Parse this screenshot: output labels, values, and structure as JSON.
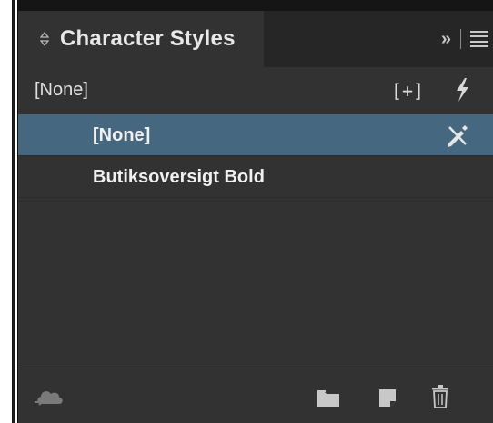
{
  "panel": {
    "tab_title": "Character Styles",
    "tab_sort_icon": "up-down-arrows-icon",
    "collapse_label": "»",
    "menu_icon": "hamburger-menu-icon"
  },
  "current_style": {
    "label": "[None]",
    "override_label": "[+]",
    "override_icon": "clear-overrides-icon",
    "quick_apply_icon": "lightning-icon"
  },
  "styles_list": [
    {
      "label": "[None]",
      "selected": true,
      "icon": "pencil-cross-icon"
    },
    {
      "label": "Butiksoversigt Bold",
      "selected": false
    }
  ],
  "bottom_toolbar": {
    "icons": [
      "cc-libraries-cloud-icon",
      "new-folder-icon",
      "new-style-icon",
      "trash-icon"
    ]
  },
  "colors": {
    "panel_bg": "#323232",
    "tab_bar_bg": "#262626",
    "selected_row": "#45677f",
    "text": "#e8e8e8"
  }
}
